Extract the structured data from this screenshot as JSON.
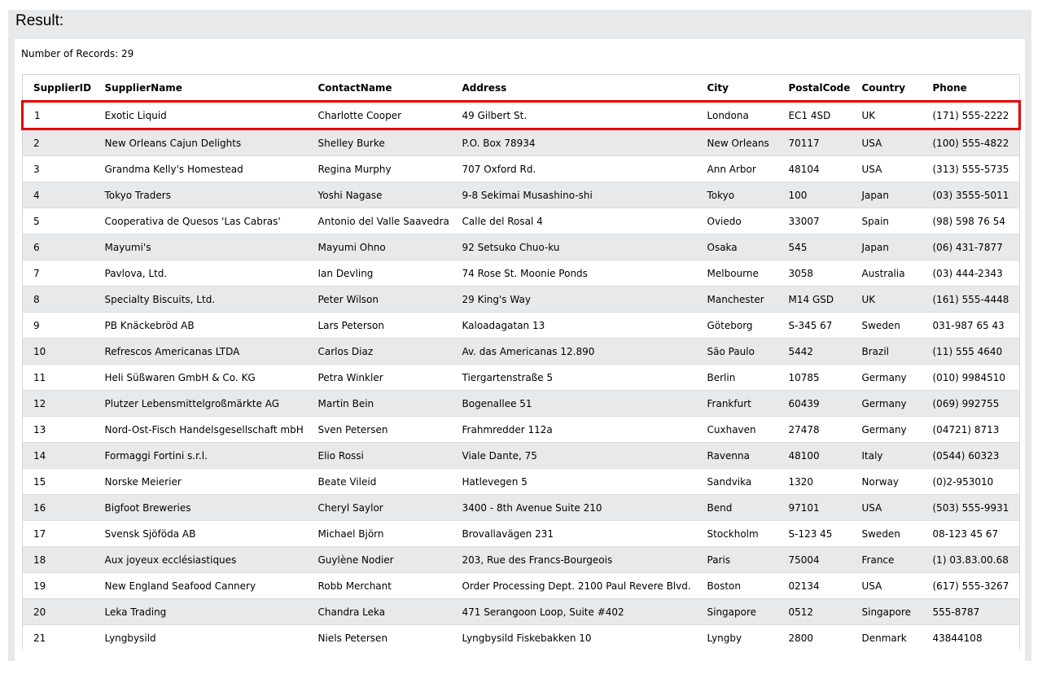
{
  "result": {
    "title": "Result:",
    "records_label": "Number of Records: 29"
  },
  "table": {
    "columns": [
      "SupplierID",
      "SupplierName",
      "ContactName",
      "Address",
      "City",
      "PostalCode",
      "Country",
      "Phone"
    ],
    "rows": [
      [
        "1",
        "Exotic Liquid",
        "Charlotte Cooper",
        "49 Gilbert St.",
        "Londona",
        "EC1 4SD",
        "UK",
        "(171) 555-2222"
      ],
      [
        "2",
        "New Orleans Cajun Delights",
        "Shelley Burke",
        "P.O. Box 78934",
        "New Orleans",
        "70117",
        "USA",
        "(100) 555-4822"
      ],
      [
        "3",
        "Grandma Kelly's Homestead",
        "Regina Murphy",
        "707 Oxford Rd.",
        "Ann Arbor",
        "48104",
        "USA",
        "(313) 555-5735"
      ],
      [
        "4",
        "Tokyo Traders",
        "Yoshi Nagase",
        "9-8 Sekimai Musashino-shi",
        "Tokyo",
        "100",
        "Japan",
        "(03) 3555-5011"
      ],
      [
        "5",
        "Cooperativa de Quesos 'Las Cabras'",
        "Antonio del Valle Saavedra",
        "Calle del Rosal 4",
        "Oviedo",
        "33007",
        "Spain",
        "(98) 598 76 54"
      ],
      [
        "6",
        "Mayumi's",
        "Mayumi Ohno",
        "92 Setsuko Chuo-ku",
        "Osaka",
        "545",
        "Japan",
        "(06) 431-7877"
      ],
      [
        "7",
        "Pavlova, Ltd.",
        "Ian Devling",
        "74 Rose St. Moonie Ponds",
        "Melbourne",
        "3058",
        "Australia",
        "(03) 444-2343"
      ],
      [
        "8",
        "Specialty Biscuits, Ltd.",
        "Peter Wilson",
        "29 King's Way",
        "Manchester",
        "M14 GSD",
        "UK",
        "(161) 555-4448"
      ],
      [
        "9",
        "PB Knäckebröd AB",
        "Lars Peterson",
        "Kaloadagatan 13",
        "Göteborg",
        "S-345 67",
        "Sweden",
        "031-987 65 43"
      ],
      [
        "10",
        "Refrescos Americanas LTDA",
        "Carlos Diaz",
        "Av. das Americanas 12.890",
        "São Paulo",
        "5442",
        "Brazil",
        "(11) 555 4640"
      ],
      [
        "11",
        "Heli Süßwaren GmbH & Co. KG",
        "Petra Winkler",
        "Tiergartenstraße 5",
        "Berlin",
        "10785",
        "Germany",
        "(010) 9984510"
      ],
      [
        "12",
        "Plutzer Lebensmittelgroßmärkte AG",
        "Martin Bein",
        "Bogenallee 51",
        "Frankfurt",
        "60439",
        "Germany",
        "(069) 992755"
      ],
      [
        "13",
        "Nord-Ost-Fisch Handelsgesellschaft mbH",
        "Sven Petersen",
        "Frahmredder 112a",
        "Cuxhaven",
        "27478",
        "Germany",
        "(04721) 8713"
      ],
      [
        "14",
        "Formaggi Fortini s.r.l.",
        "Elio Rossi",
        "Viale Dante, 75",
        "Ravenna",
        "48100",
        "Italy",
        "(0544) 60323"
      ],
      [
        "15",
        "Norske Meierier",
        "Beate Vileid",
        "Hatlevegen 5",
        "Sandvika",
        "1320",
        "Norway",
        "(0)2-953010"
      ],
      [
        "16",
        "Bigfoot Breweries",
        "Cheryl Saylor",
        "3400 - 8th Avenue Suite 210",
        "Bend",
        "97101",
        "USA",
        "(503) 555-9931"
      ],
      [
        "17",
        "Svensk Sjöföda AB",
        "Michael Björn",
        "Brovallavägen 231",
        "Stockholm",
        "S-123 45",
        "Sweden",
        "08-123 45 67"
      ],
      [
        "18",
        "Aux joyeux ecclésiastiques",
        "Guylène Nodier",
        "203, Rue des Francs-Bourgeois",
        "Paris",
        "75004",
        "France",
        "(1) 03.83.00.68"
      ],
      [
        "19",
        "New England Seafood Cannery",
        "Robb Merchant",
        "Order Processing Dept. 2100 Paul Revere Blvd.",
        "Boston",
        "02134",
        "USA",
        "(617) 555-3267"
      ],
      [
        "20",
        "Leka Trading",
        "Chandra Leka",
        "471 Serangoon Loop, Suite #402",
        "Singapore",
        "0512",
        "Singapore",
        "555-8787"
      ],
      [
        "21",
        "Lyngbysild",
        "Niels Petersen",
        "Lyngbysild Fiskebakken 10",
        "Lyngby",
        "2800",
        "Denmark",
        "43844108"
      ]
    ],
    "highlight_color": "#e00000",
    "alt_row_color": "#e8e9eb"
  }
}
